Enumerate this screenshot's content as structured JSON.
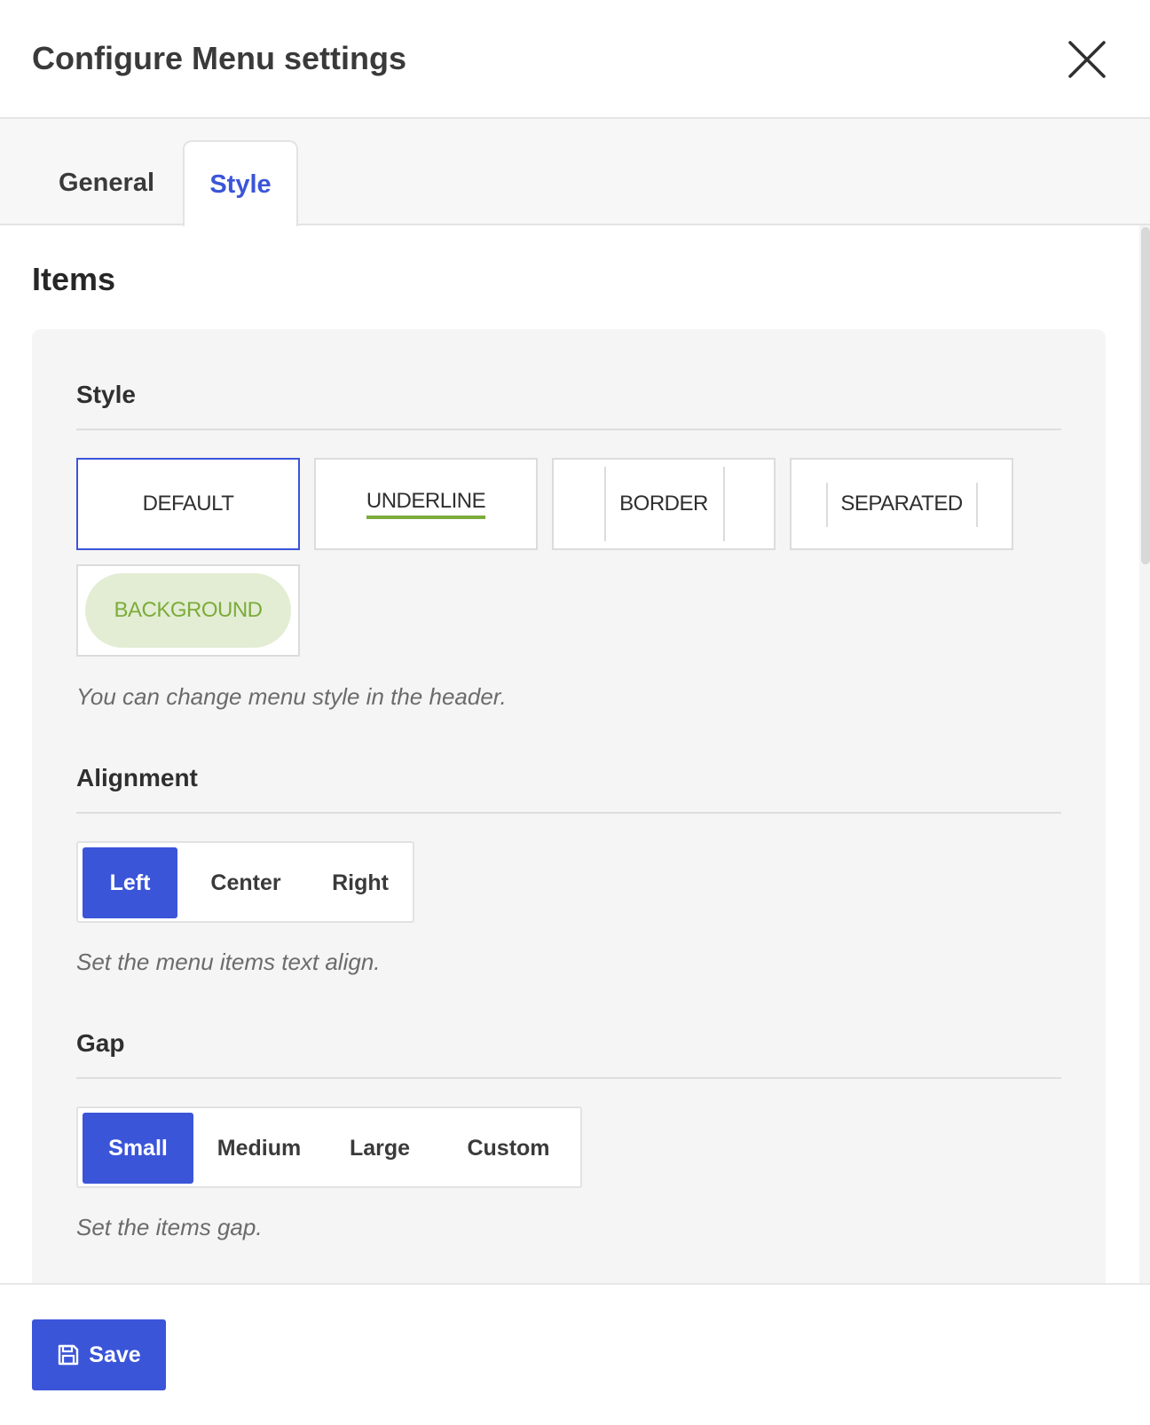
{
  "dialog": {
    "title": "Configure Menu settings",
    "close_icon": "close-icon"
  },
  "tabs": [
    {
      "label": "General",
      "active": false
    },
    {
      "label": "Style",
      "active": true
    }
  ],
  "section": {
    "title": "Items"
  },
  "style_group": {
    "label": "Style",
    "options": [
      {
        "label": "DEFAULT",
        "selected": true
      },
      {
        "label": "UNDERLINE",
        "selected": false
      },
      {
        "label": "BORDER",
        "selected": false
      },
      {
        "label": "SEPARATED",
        "selected": false
      },
      {
        "label": "BACKGROUND",
        "selected": false
      }
    ],
    "hint": "You can change menu style in the header."
  },
  "alignment_group": {
    "label": "Alignment",
    "options": [
      {
        "label": "Left",
        "active": true
      },
      {
        "label": "Center",
        "active": false
      },
      {
        "label": "Right",
        "active": false
      }
    ],
    "hint": "Set the menu items text align."
  },
  "gap_group": {
    "label": "Gap",
    "options": [
      {
        "label": "Small",
        "active": true
      },
      {
        "label": "Medium",
        "active": false
      },
      {
        "label": "Large",
        "active": false
      },
      {
        "label": "Custom",
        "active": false
      }
    ],
    "hint": "Set the items gap."
  },
  "footer": {
    "save_label": "Save",
    "save_icon": "save-icon"
  },
  "colors": {
    "accent": "#3b55d9",
    "underline_green": "#7cac3a",
    "background_pill": "#e3edd4",
    "panel_bg": "#f5f5f5"
  }
}
